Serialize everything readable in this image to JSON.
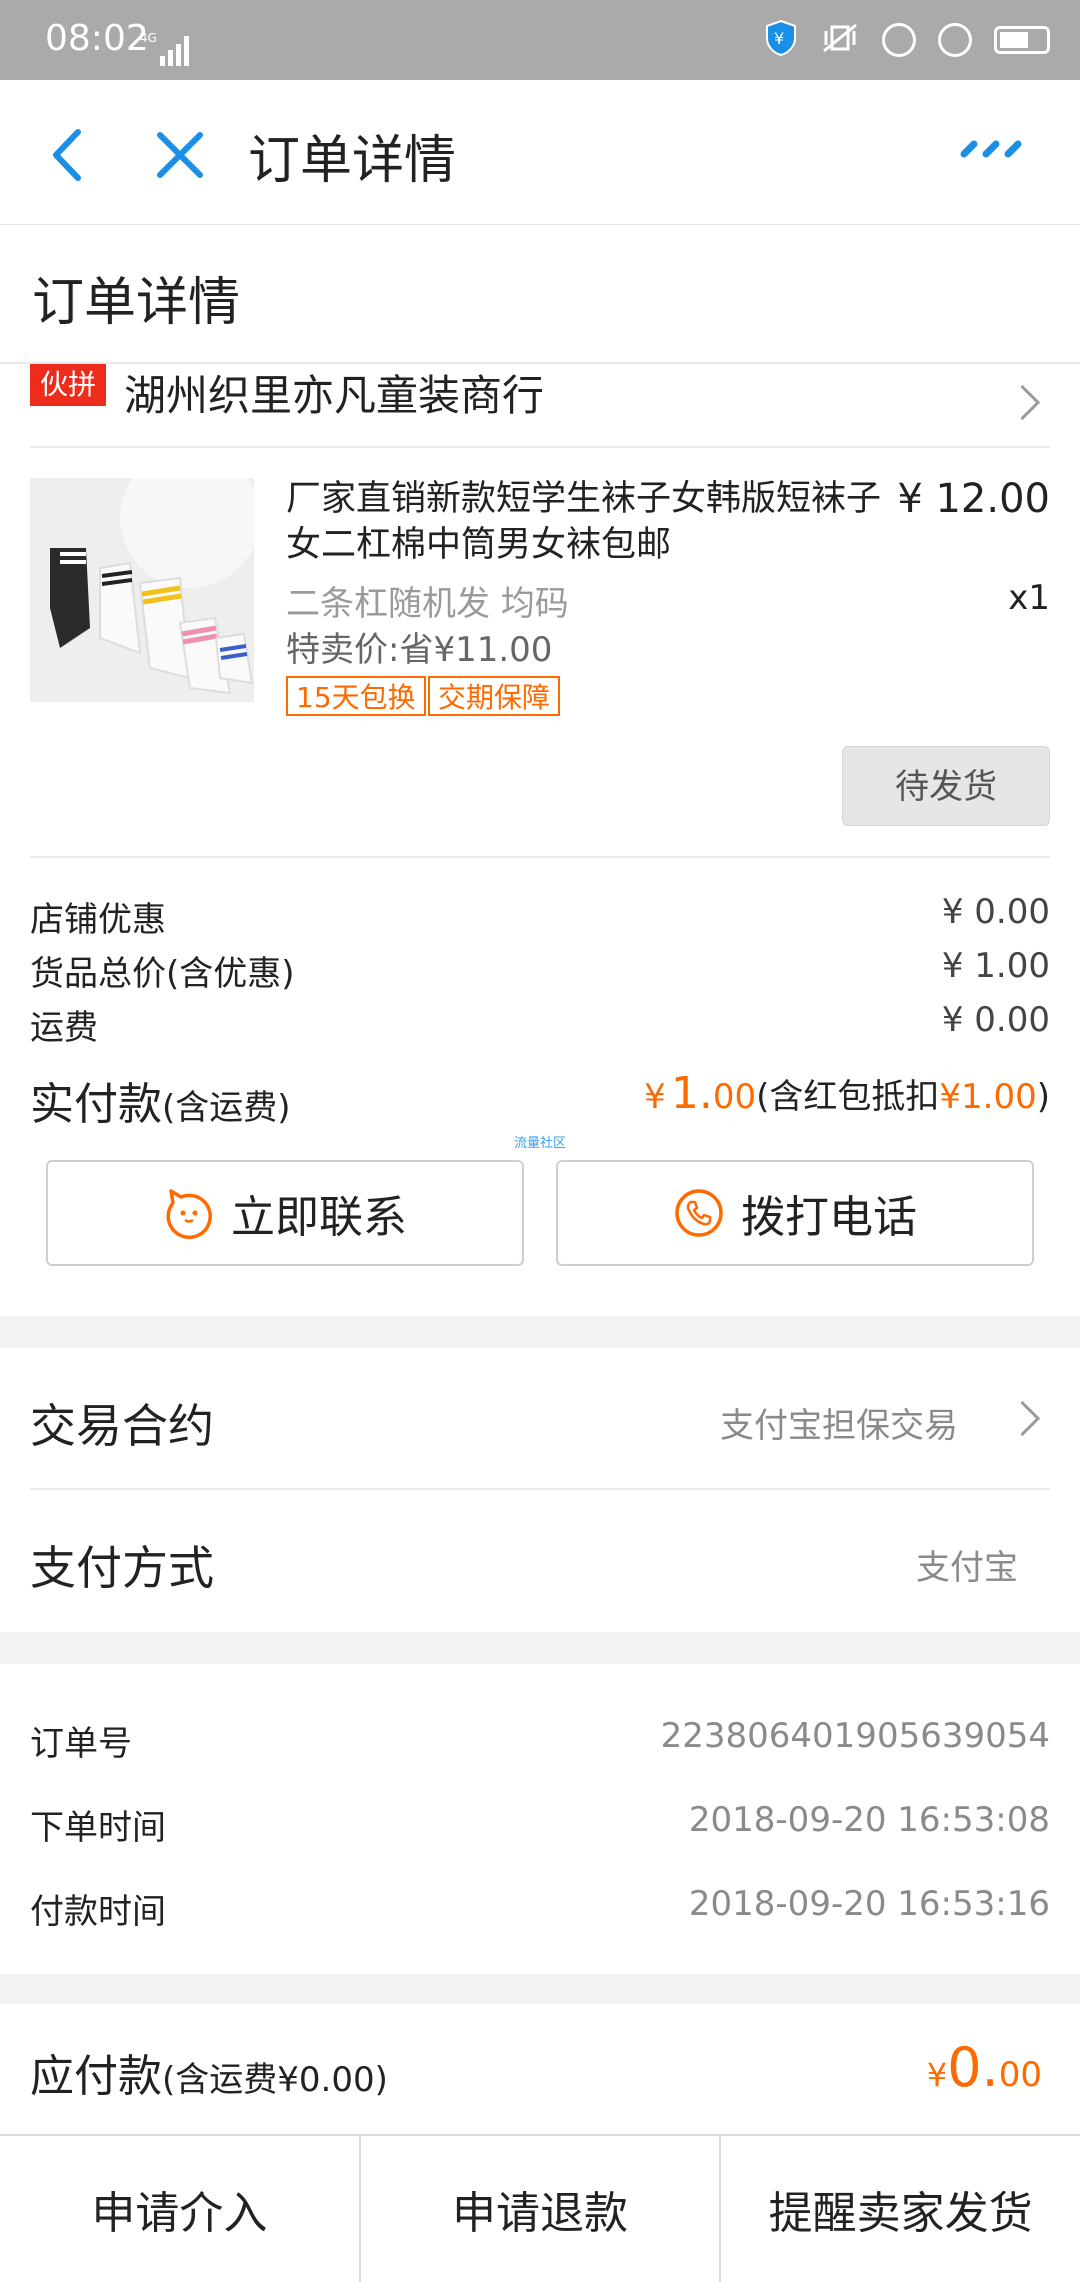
{
  "status_bar": {
    "time": "08:02",
    "network": "4G"
  },
  "nav": {
    "title": "订单详情"
  },
  "page": {
    "title": "订单详情"
  },
  "shop": {
    "badge": "伙拼",
    "name": "湖州织里亦凡童装商行"
  },
  "product": {
    "title": "厂家直销新款短学生袜子女韩版短袜子女二杠棉中筒男女袜包邮",
    "price": "¥ 12.00",
    "spec": "二条杠随机发 均码",
    "qty": "x1",
    "sale": "特卖价:省¥11.00",
    "tags": [
      "15天包换",
      "交期保障"
    ],
    "status": "待发货"
  },
  "costs": {
    "rows": [
      {
        "label": "店铺优惠",
        "value": "¥ 0.00"
      },
      {
        "label": "货品总价(含优惠)",
        "value": "¥ 1.00"
      },
      {
        "label": "运费",
        "value": "¥ 0.00"
      }
    ],
    "paid_label": "实付款",
    "paid_suffix": "(含运费)",
    "paid_currency": "¥",
    "paid_int": "1.",
    "paid_dec": "00",
    "paid_note_prefix": "(含红包抵扣",
    "paid_note_amount": "¥1.00",
    "paid_note_suffix": ")",
    "watermark": "流量社区"
  },
  "actions": {
    "contact": "立即联系",
    "call": "拨打电话"
  },
  "trade": {
    "contract_label": "交易合约",
    "contract_value": "支付宝担保交易",
    "payment_label": "支付方式",
    "payment_value": "支付宝"
  },
  "order": {
    "rows": [
      {
        "label": "订单号",
        "value": "223806401905639054"
      },
      {
        "label": "下单时间",
        "value": "2018-09-20 16:53:08"
      },
      {
        "label": "付款时间",
        "value": "2018-09-20 16:53:16"
      }
    ]
  },
  "due": {
    "label": "应付款",
    "suffix": "(含运费¥0.00)",
    "currency": "¥",
    "int": "0.",
    "dec": "00"
  },
  "bottom": {
    "intervene": "申请介入",
    "refund": "申请退款",
    "remind": "提醒卖家发货"
  },
  "colors": {
    "accent": "#ff6a00",
    "nav_blue": "#1b8fe6",
    "badge_red": "#ee2c1b"
  }
}
